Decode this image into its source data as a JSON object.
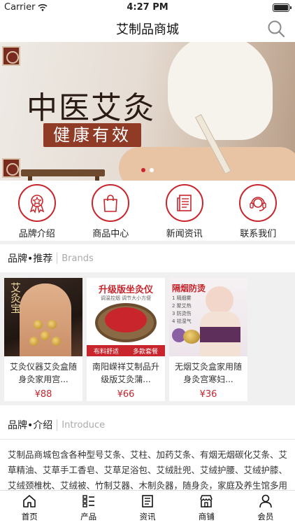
{
  "status_bar": {
    "carrier": "Carrier",
    "time": "4:27 PM"
  },
  "nav": {
    "title": "艾制品商城",
    "search_icon": "search-icon"
  },
  "banner": {
    "headline": "中医艾灸",
    "subline": "健康有效",
    "slide_count": 2,
    "active_slide": 1
  },
  "quick_nav": [
    {
      "label": "品牌介绍",
      "icon": "award-badge-icon"
    },
    {
      "label": "商品中心",
      "icon": "shopping-bag-icon"
    },
    {
      "label": "新闻资讯",
      "icon": "news-document-icon"
    },
    {
      "label": "联系我们",
      "icon": "headset-icon"
    }
  ],
  "brands_section": {
    "title": "品牌•推荐",
    "subtitle": "Brands"
  },
  "products": [
    {
      "name": "艾灸仪器艾灸盒随身灸家用宫...",
      "price": "¥88",
      "image_text": "艾灸宝"
    },
    {
      "name": "南阳嵘祥艾制品升级版艾灸蒲...",
      "price": "¥66",
      "image_text": "升级版坐灸仪",
      "image_small": "调温控烟 调节大小方便",
      "image_strip_left": "布料舒适",
      "image_strip_right": "多款套餐"
    },
    {
      "name": "无烟艾灸盒家用随身灸宫寒妇...",
      "price": "¥36",
      "image_text": "隔烟防烫",
      "image_list": [
        "1 隔烟雾",
        "2 聚艾热",
        "3 防烫伤",
        "4 祛湿气"
      ]
    }
  ],
  "intro_section": {
    "title": "品牌•介绍",
    "subtitle": "Introduce",
    "body": "艾制品商城包含各种型号艾条、艾柱、加药艾条、有烟无烟碳化艾条、艾草精油、艾草手工香皂、艾草足浴包、艾绒肚兜、艾绒护腰、艾绒护膝、艾绒颈椎枕、艾绒被、竹制艾器、木制灸器，随身灸，家庭及养生馆多用"
  },
  "tab_bar": [
    {
      "label": "首页",
      "icon": "home-icon"
    },
    {
      "label": "产品",
      "icon": "product-list-icon"
    },
    {
      "label": "资讯",
      "icon": "news-icon"
    },
    {
      "label": "商铺",
      "icon": "store-icon"
    },
    {
      "label": "会员",
      "icon": "user-icon"
    }
  ],
  "colors": {
    "accent": "#c8252c",
    "section_bg": "#f0f0f0"
  }
}
